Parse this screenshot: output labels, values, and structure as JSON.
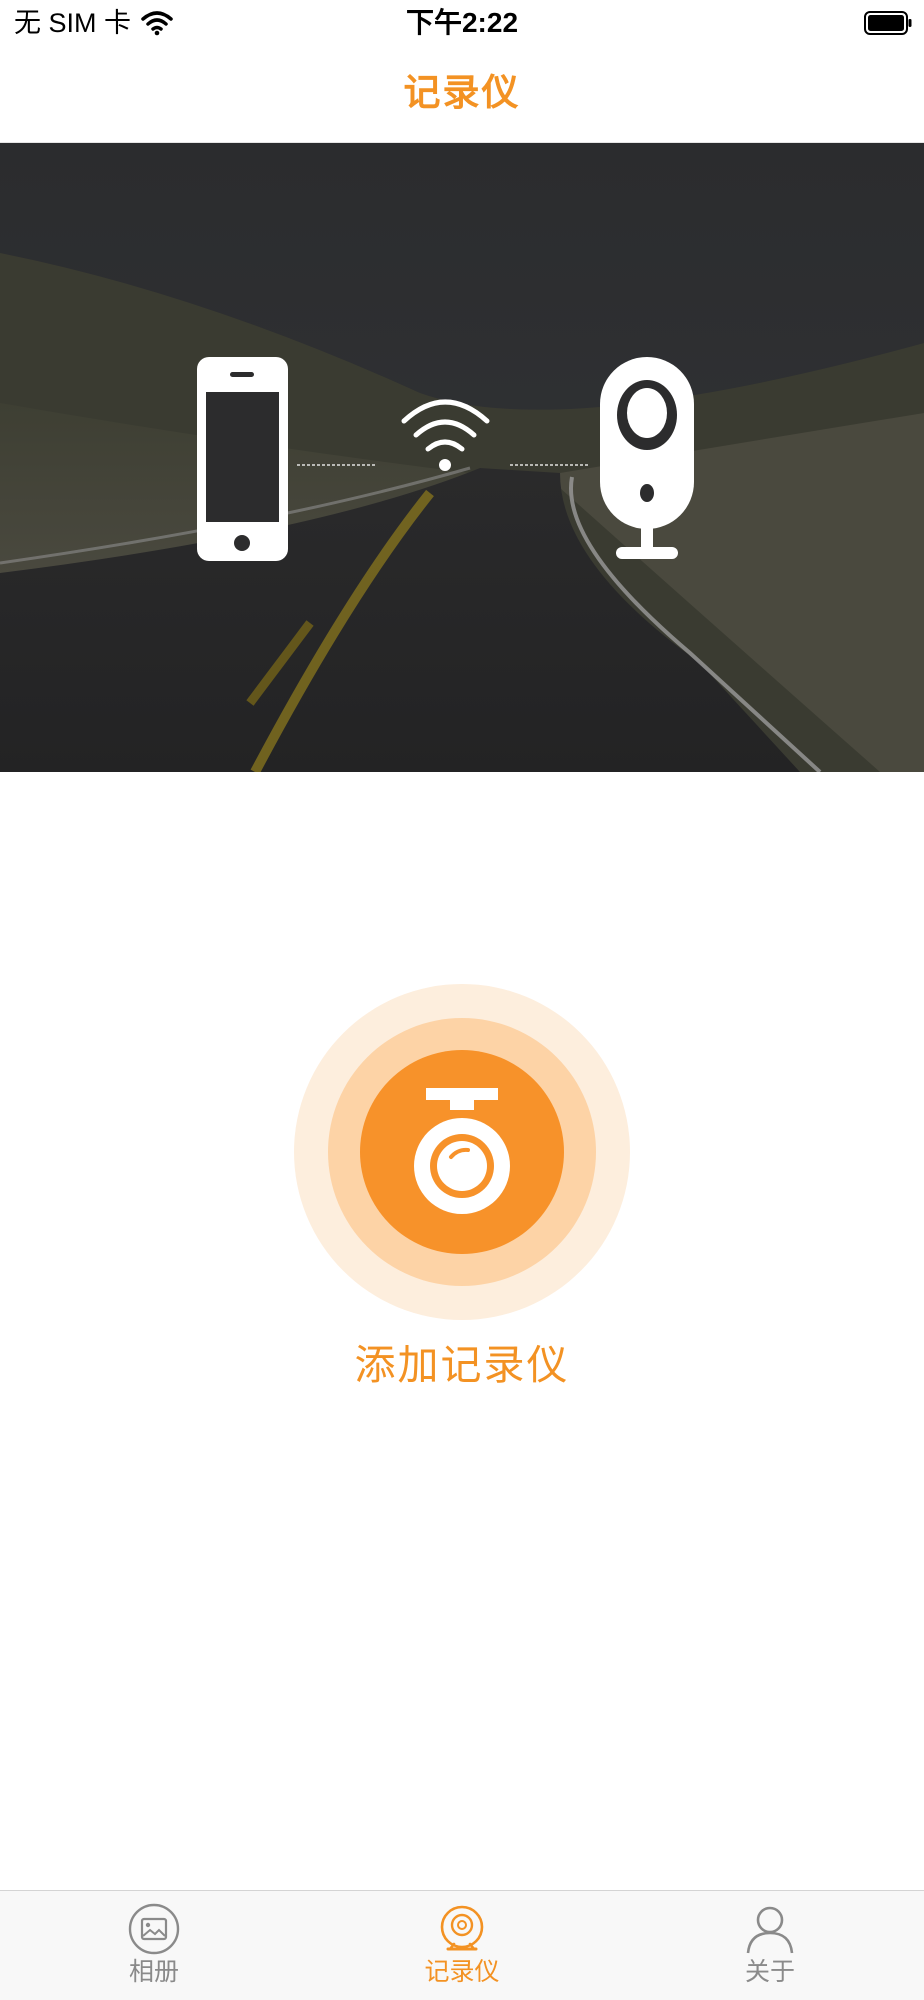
{
  "status_bar": {
    "carrier": "无 SIM 卡",
    "time": "下午2:22",
    "wifi_icon": "wifi-icon",
    "battery_icon": "battery-full-icon"
  },
  "nav": {
    "title": "记录仪"
  },
  "hero": {
    "left_icon": "smartphone-icon",
    "center_icon": "wifi-signal-icon",
    "right_icon": "dashcam-device-icon",
    "background": "road-landscape-image"
  },
  "add_device": {
    "label": "添加记录仪",
    "icon": "dashcam-icon"
  },
  "tab_bar": {
    "tabs": [
      {
        "label": "相册",
        "icon": "photo-album-icon",
        "active": false
      },
      {
        "label": "记录仪",
        "icon": "recorder-icon",
        "active": true
      },
      {
        "label": "关于",
        "icon": "person-icon",
        "active": false
      }
    ]
  },
  "colors": {
    "accent": "#f39223",
    "ring_outer": "#fdeedd",
    "ring_mid": "#fdd3a6",
    "ring_inner": "#f7922a",
    "tab_inactive": "#8a8a8a"
  }
}
